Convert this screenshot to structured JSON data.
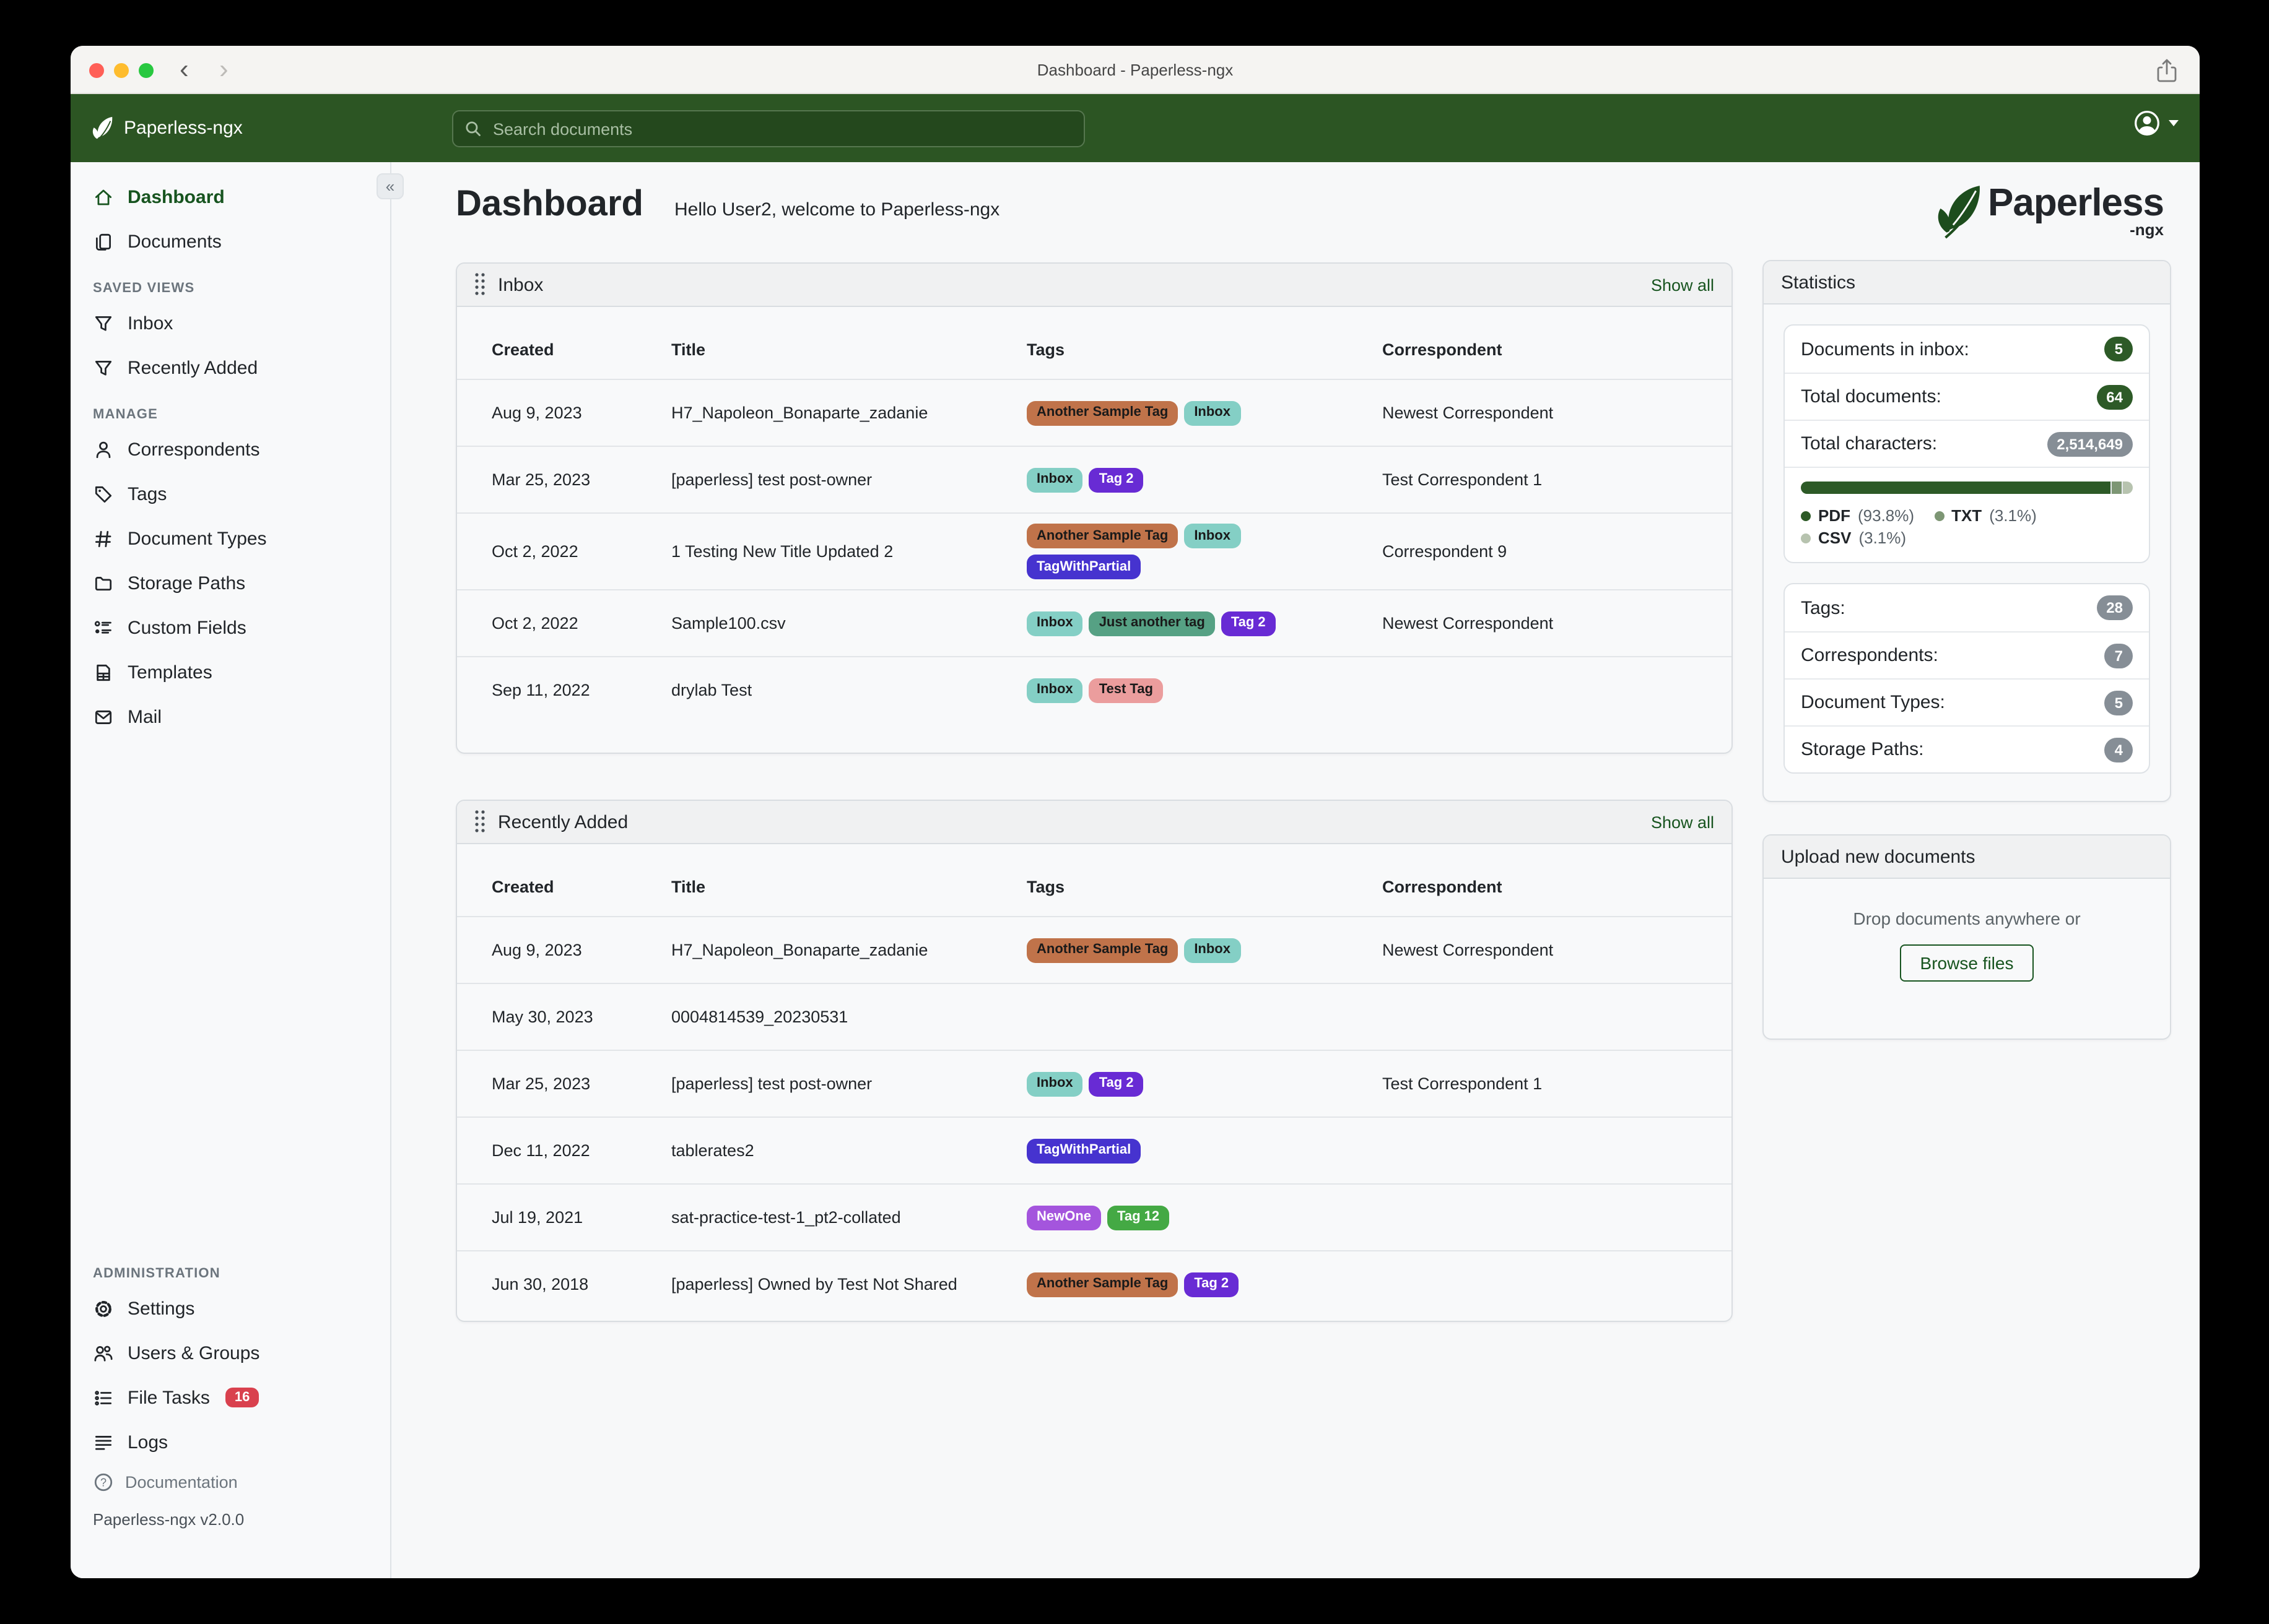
{
  "titlebar": {
    "title": "Dashboard - Paperless-ngx",
    "back_glyph": "‹",
    "forward_glyph": "›"
  },
  "header": {
    "brand": "Paperless-ngx",
    "search_placeholder": "Search documents"
  },
  "sidebar": {
    "collapse_glyph": "«",
    "items_top": [
      {
        "label": "Dashboard",
        "icon": "home",
        "active": true
      },
      {
        "label": "Documents",
        "icon": "documents",
        "active": false
      }
    ],
    "sections": [
      {
        "title": "SAVED VIEWS",
        "items": [
          {
            "label": "Inbox",
            "icon": "filter"
          },
          {
            "label": "Recently Added",
            "icon": "filter"
          }
        ]
      },
      {
        "title": "MANAGE",
        "items": [
          {
            "label": "Correspondents",
            "icon": "person"
          },
          {
            "label": "Tags",
            "icon": "tag"
          },
          {
            "label": "Document Types",
            "icon": "hash"
          },
          {
            "label": "Storage Paths",
            "icon": "folder"
          },
          {
            "label": "Custom Fields",
            "icon": "fields"
          },
          {
            "label": "Templates",
            "icon": "template"
          },
          {
            "label": "Mail",
            "icon": "mail"
          }
        ]
      },
      {
        "title": "ADMINISTRATION",
        "items": [
          {
            "label": "Settings",
            "icon": "gear"
          },
          {
            "label": "Users & Groups",
            "icon": "users"
          },
          {
            "label": "File Tasks",
            "icon": "tasks",
            "badge": "16"
          },
          {
            "label": "Logs",
            "icon": "logs"
          }
        ]
      }
    ],
    "footer_link": {
      "label": "Documentation",
      "icon": "help"
    },
    "version": "Paperless-ngx v2.0.0"
  },
  "page": {
    "heading": "Dashboard",
    "greeting": "Hello User2, welcome to Paperless-ngx",
    "logo_text": "Paperless",
    "logo_suffix": "-ngx"
  },
  "tag_palette": {
    "Another Sample Tag": {
      "bg": "#c0734a",
      "fg": "#1a1a1a"
    },
    "Inbox": {
      "bg": "#84cfc5",
      "fg": "#1a1a1a"
    },
    "Tag 2": {
      "bg": "#682bd4",
      "fg": "#ffffff"
    },
    "TagWithPartial": {
      "bg": "#4633cf",
      "fg": "#ffffff"
    },
    "Just another tag": {
      "bg": "#56a184",
      "fg": "#1a1a1a"
    },
    "Test Tag": {
      "bg": "#eb9d9d",
      "fg": "#1a1a1a"
    },
    "NewOne": {
      "bg": "#a455dd",
      "fg": "#ffffff"
    },
    "Tag 12": {
      "bg": "#44a944",
      "fg": "#ffffff"
    }
  },
  "cards": [
    {
      "title": "Inbox",
      "show_all": "Show all",
      "columns": [
        "Created",
        "Title",
        "Tags",
        "Correspondent"
      ],
      "rows": [
        {
          "created": "Aug 9, 2023",
          "title": "H7_Napoleon_Bonaparte_zadanie",
          "tags": [
            "Another Sample Tag",
            "Inbox"
          ],
          "correspondent": "Newest Correspondent"
        },
        {
          "created": "Mar 25, 2023",
          "title": "[paperless] test post-owner",
          "tags": [
            "Inbox",
            "Tag 2"
          ],
          "correspondent": "Test Correspondent 1"
        },
        {
          "created": "Oct 2, 2022",
          "title": "1 Testing New Title Updated 2",
          "tags": [
            "Another Sample Tag",
            "Inbox",
            "TagWithPartial"
          ],
          "correspondent": "Correspondent 9"
        },
        {
          "created": "Oct 2, 2022",
          "title": "Sample100.csv",
          "tags": [
            "Inbox",
            "Just another tag",
            "Tag 2"
          ],
          "correspondent": "Newest Correspondent"
        },
        {
          "created": "Sep 11, 2022",
          "title": "drylab Test",
          "tags": [
            "Inbox",
            "Test Tag"
          ],
          "correspondent": ""
        }
      ]
    },
    {
      "title": "Recently Added",
      "show_all": "Show all",
      "columns": [
        "Created",
        "Title",
        "Tags",
        "Correspondent"
      ],
      "rows": [
        {
          "created": "Aug 9, 2023",
          "title": "H7_Napoleon_Bonaparte_zadanie",
          "tags": [
            "Another Sample Tag",
            "Inbox"
          ],
          "correspondent": "Newest Correspondent"
        },
        {
          "created": "May 30, 2023",
          "title": "0004814539_20230531",
          "tags": [],
          "correspondent": ""
        },
        {
          "created": "Mar 25, 2023",
          "title": "[paperless] test post-owner",
          "tags": [
            "Inbox",
            "Tag 2"
          ],
          "correspondent": "Test Correspondent 1"
        },
        {
          "created": "Dec 11, 2022",
          "title": "tablerates2",
          "tags": [
            "TagWithPartial"
          ],
          "correspondent": ""
        },
        {
          "created": "Jul 19, 2021",
          "title": "sat-practice-test-1_pt2-collated",
          "tags": [
            "NewOne",
            "Tag 12"
          ],
          "correspondent": ""
        },
        {
          "created": "Jun 30, 2018",
          "title": "[paperless] Owned by Test Not Shared",
          "tags": [
            "Another Sample Tag",
            "Tag 2"
          ],
          "correspondent": ""
        }
      ]
    }
  ],
  "statistics": {
    "title": "Statistics",
    "count_rows": [
      {
        "label": "Documents in inbox:",
        "value": "5",
        "style": "green"
      },
      {
        "label": "Total documents:",
        "value": "64",
        "style": "green"
      },
      {
        "label": "Total characters:",
        "value": "2,514,649",
        "style": "gray"
      }
    ],
    "file_types": [
      {
        "label": "PDF",
        "pct": "93.8%",
        "value": 93.8,
        "color": "#2d5a27"
      },
      {
        "label": "TXT",
        "pct": "3.1%",
        "value": 3.1,
        "color": "#7d9674"
      },
      {
        "label": "CSV",
        "pct": "3.1%",
        "value": 3.1,
        "color": "#b7c3af"
      }
    ],
    "meta_rows": [
      {
        "label": "Tags:",
        "value": "28"
      },
      {
        "label": "Correspondents:",
        "value": "7"
      },
      {
        "label": "Document Types:",
        "value": "5"
      },
      {
        "label": "Storage Paths:",
        "value": "4"
      }
    ]
  },
  "upload": {
    "title": "Upload new documents",
    "hint": "Drop documents anywhere or",
    "button_label": "Browse files"
  }
}
